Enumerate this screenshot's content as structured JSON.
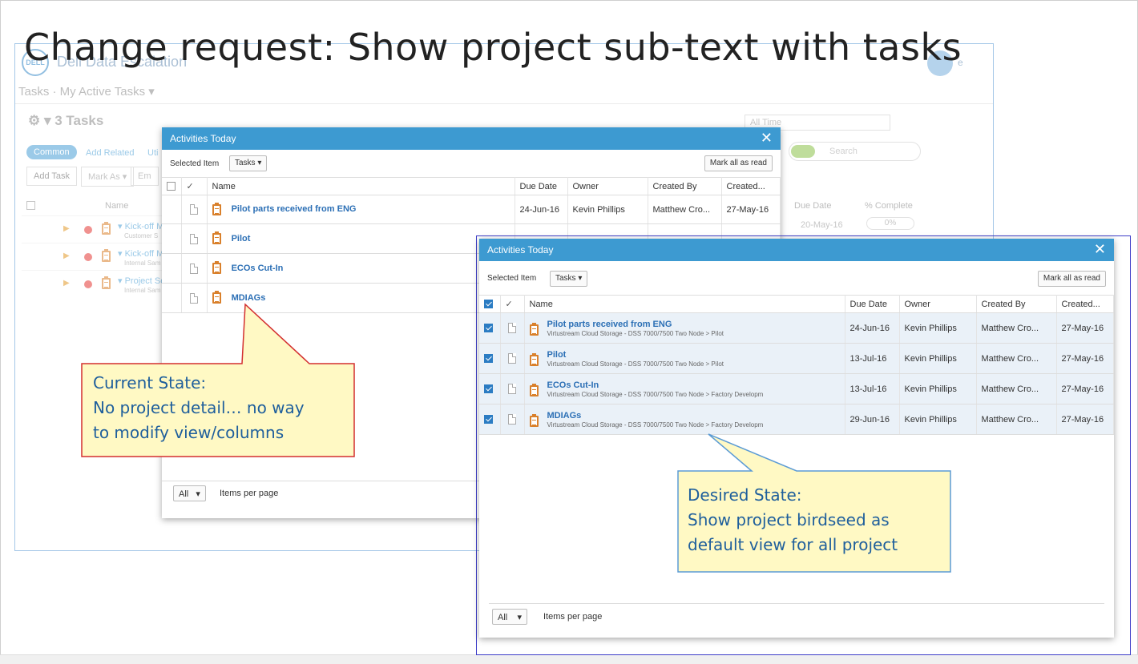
{
  "slide": {
    "title": "Change request: Show project sub-text with tasks"
  },
  "background_app": {
    "logo_text": "DELL",
    "app_title": "Dell Data Escalation",
    "breadcrumb": "Tasks · My Active Tasks ▾",
    "task_count": "⚙ ▾  3 Tasks",
    "pills": [
      "Common",
      "Add Related",
      "Uti"
    ],
    "buttons": [
      "Add Task",
      "Mark As ▾",
      "Em"
    ],
    "header_name": "Name",
    "rows": [
      {
        "name": "▾ Kick-off Me",
        "sub": "Customer S"
      },
      {
        "name": "▾ Kick-off Me",
        "sub": "Internal Sam"
      },
      {
        "name": "▾ Project Set",
        "sub": "Internal Sam"
      }
    ],
    "time_filter": "All Time",
    "search_placeholder": "Search",
    "col_due": "Due Date",
    "col_pct": "% Complete",
    "due_value": "20-May-16",
    "pct_value": "0%",
    "user_name": "e"
  },
  "old_modal": {
    "title": "Activities Today",
    "selected_item_label": "Selected Item",
    "selected_item_value": "Tasks ▾",
    "mark_all": "Mark all as read",
    "columns": [
      "Name",
      "Due Date",
      "Owner",
      "Created By",
      "Created..."
    ],
    "rows": [
      {
        "name": "Pilot parts received from ENG",
        "due": "24-Jun-16",
        "owner": "Kevin Phillips",
        "created_by": "Matthew Cro...",
        "created": "27-May-16"
      },
      {
        "name": "Pilot",
        "due": "",
        "owner": "",
        "created_by": "",
        "created": ""
      },
      {
        "name": "ECOs Cut-In",
        "due": "",
        "owner": "",
        "created_by": "",
        "created": ""
      },
      {
        "name": "MDIAGs",
        "due": "",
        "owner": "",
        "created_by": "",
        "created": ""
      }
    ],
    "footer_select": "All",
    "footer_label": "Items per page"
  },
  "new_modal": {
    "title": "Activities Today",
    "selected_item_label": "Selected Item",
    "selected_item_value": "Tasks ▾",
    "mark_all": "Mark all as read",
    "columns": [
      "Name",
      "Due Date",
      "Owner",
      "Created By",
      "Created..."
    ],
    "rows": [
      {
        "name": "Pilot parts received from ENG",
        "sub": "Virtustream Cloud Storage - DSS 7000/7500 Two Node > Pilot",
        "due": "24-Jun-16",
        "owner": "Kevin Phillips",
        "created_by": "Matthew Cro...",
        "created": "27-May-16"
      },
      {
        "name": "Pilot",
        "sub": "Virtustream Cloud Storage - DSS 7000/7500 Two Node > Pilot",
        "due": "13-Jul-16",
        "owner": "Kevin Phillips",
        "created_by": "Matthew Cro...",
        "created": "27-May-16"
      },
      {
        "name": "ECOs Cut-In",
        "sub": "Virtustream Cloud Storage - DSS 7000/7500 Two Node > Factory Developm",
        "due": "13-Jul-16",
        "owner": "Kevin Phillips",
        "created_by": "Matthew Cro...",
        "created": "27-May-16"
      },
      {
        "name": "MDIAGs",
        "sub": "Virtustream Cloud Storage - DSS 7000/7500 Two Node > Factory Developm",
        "due": "29-Jun-16",
        "owner": "Kevin Phillips",
        "created_by": "Matthew Cro...",
        "created": "27-May-16"
      }
    ],
    "footer_select": "All",
    "footer_label": "Items per page"
  },
  "callouts": {
    "current": [
      "Current State:",
      "No project detail… no way",
      "to modify view/columns"
    ],
    "desired": [
      "Desired State:",
      "Show project birdseed as",
      "default view for all project"
    ]
  },
  "colors": {
    "header_blue": "#3d9ad1",
    "link_blue": "#2b6fb5",
    "callout_fill": "#fff9c4",
    "current_border": "#d32f2f",
    "desired_border": "#5b9bd5"
  }
}
